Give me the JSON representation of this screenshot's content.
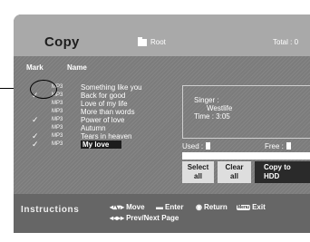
{
  "window": {
    "title": "Copy",
    "folder": "Root",
    "total": "Total : 0"
  },
  "list": {
    "header_mark": "Mark",
    "header_name": "Name",
    "check_glyph": "✓",
    "format": "MP3",
    "items": [
      {
        "name": "Something like you",
        "checked": false,
        "selected": false
      },
      {
        "name": "Back for good",
        "checked": true,
        "selected": false
      },
      {
        "name": "Love of my life",
        "checked": false,
        "selected": false
      },
      {
        "name": "More than words",
        "checked": false,
        "selected": false
      },
      {
        "name": "Power of love",
        "checked": true,
        "selected": false
      },
      {
        "name": "Autumn",
        "checked": false,
        "selected": false
      },
      {
        "name": "Tears in heaven",
        "checked": true,
        "selected": false
      },
      {
        "name": "My love",
        "checked": true,
        "selected": true
      }
    ]
  },
  "info": {
    "singer_label": "Singer :",
    "singer_value": "Westlife",
    "time": "Time : 3:05"
  },
  "storage": {
    "used_label": "Used :",
    "free_label": "Free :"
  },
  "buttons": {
    "select_all": {
      "line1": "Select",
      "line2": "all"
    },
    "clear_all": {
      "line1": "Clear",
      "line2": "all"
    },
    "copy": {
      "line1": "Copy to",
      "line2": "HDD"
    }
  },
  "instructions": {
    "title": "Instructions",
    "move": "Move",
    "enter": "Enter",
    "return": "Return",
    "menu_badge": "Menu",
    "exit": "Exit",
    "prev_next": "Prev/Next Page",
    "icons": {
      "move": "arrows-icon",
      "enter": "enter-icon",
      "return": "return-icon",
      "menu": "menu-icon",
      "page": "page-arrows-icon"
    }
  },
  "colors": {
    "title_bar": "#a9a9a9",
    "body": "#7c7c7c",
    "footer": "#666666",
    "selected_row": "#1c1c1c"
  }
}
